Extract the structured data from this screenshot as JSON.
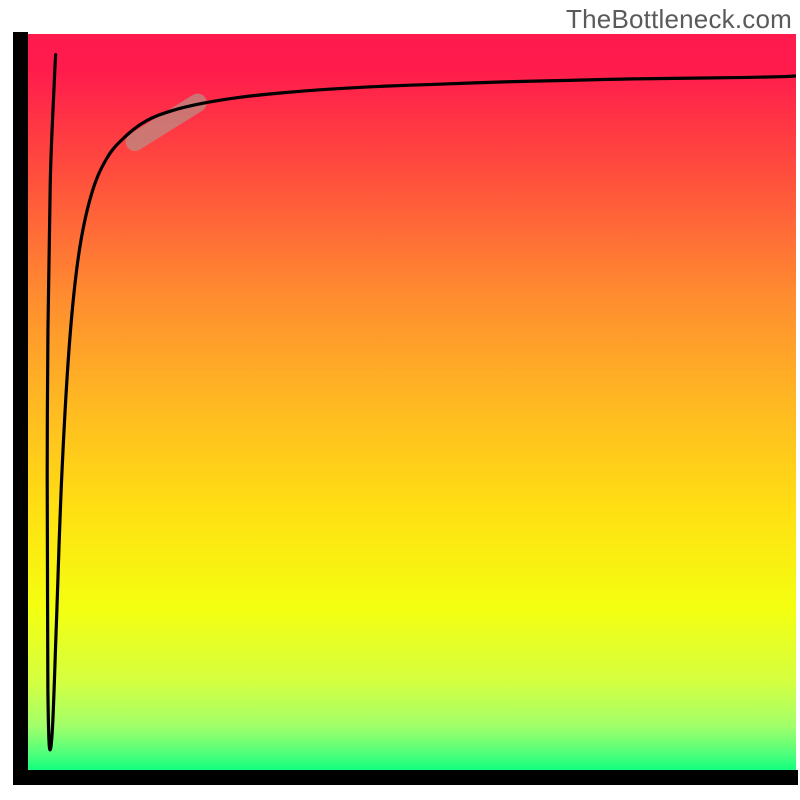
{
  "watermark": "TheBottleneck.com",
  "chart_data": {
    "type": "line",
    "title": "",
    "xlabel": "",
    "ylabel": "",
    "xlim": [
      0,
      100
    ],
    "ylim": [
      0,
      100
    ],
    "legend": false,
    "gradient_stops": [
      {
        "pos": 0.0,
        "color": "#ff1a4e"
      },
      {
        "pos": 0.05,
        "color": "#ff1c4c"
      },
      {
        "pos": 0.18,
        "color": "#ff4a3e"
      },
      {
        "pos": 0.35,
        "color": "#ff8a30"
      },
      {
        "pos": 0.5,
        "color": "#ffb822"
      },
      {
        "pos": 0.65,
        "color": "#ffe012"
      },
      {
        "pos": 0.78,
        "color": "#f4ff10"
      },
      {
        "pos": 0.88,
        "color": "#d4ff40"
      },
      {
        "pos": 0.94,
        "color": "#a2ff6a"
      },
      {
        "pos": 0.975,
        "color": "#56ff7a"
      },
      {
        "pos": 1.0,
        "color": "#12ff7e"
      }
    ],
    "series": [
      {
        "name": "curve",
        "stroke": "#000000",
        "x": [
          3.6,
          3.4,
          2.9,
          2.6,
          2.5,
          2.55,
          2.6,
          2.8,
          3.2,
          3.7,
          4.4,
          5.4,
          6.6,
          8.2,
          10.2,
          12.6,
          15.4,
          18.8,
          22.8,
          27.6,
          33.0,
          39.2,
          46.2,
          54.0,
          62.0,
          70.4,
          78.8,
          86.8,
          93.6,
          98.0,
          100.0
        ],
        "y": [
          97.2,
          93.0,
          80.0,
          60.0,
          40.0,
          22.0,
          10.0,
          3.0,
          6.0,
          20.0,
          40.0,
          58.0,
          70.0,
          78.0,
          83.0,
          86.0,
          88.2,
          89.6,
          90.6,
          91.4,
          92.0,
          92.5,
          92.9,
          93.2,
          93.5,
          93.7,
          93.9,
          94.0,
          94.1,
          94.2,
          94.3
        ]
      }
    ],
    "highlight_segment": {
      "center_x": 18.0,
      "center_y": 88.0,
      "angle_deg": 32,
      "length_frac": 0.12,
      "thickness_frac": 0.025,
      "color": "#bf8880",
      "opacity": 0.78
    },
    "axis_stroke": "#000000",
    "axis_width": 5
  }
}
